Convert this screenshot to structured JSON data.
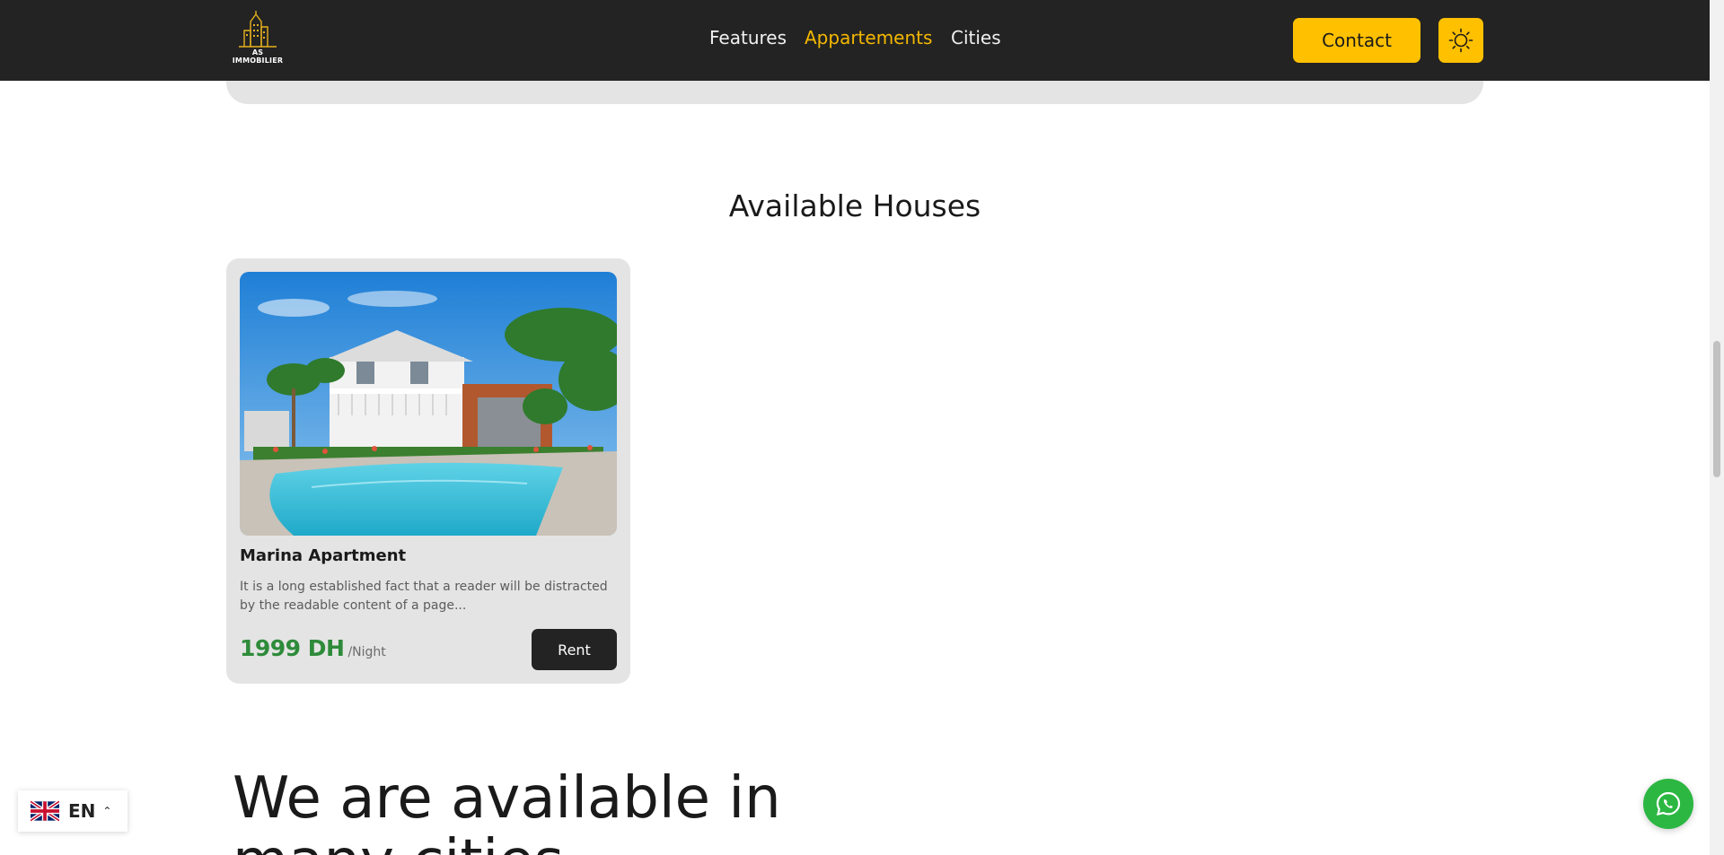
{
  "header": {
    "logo_text": "AS IMMOBILIER",
    "nav": [
      "Features",
      "Appartements",
      "Cities"
    ],
    "active_nav": "Appartements",
    "contact_label": "Contact",
    "theme_icon": "sun-icon"
  },
  "section": {
    "title": "Available Houses"
  },
  "card": {
    "title": "Marina Apartment",
    "description": "It is a long established fact that a reader will be distracted by the readable content of a page...",
    "price": "1999 DH",
    "price_unit": "/Night",
    "rent_label": "Rent"
  },
  "cities": {
    "heading": "We are available in many cities"
  },
  "language": {
    "code": "EN",
    "flag_icon": "uk-flag-icon",
    "caret_icon": "chevron-up-icon"
  },
  "whatsapp": {
    "icon": "whatsapp-icon"
  },
  "colors": {
    "accent": "#ffc000",
    "header_bg": "#232323",
    "price_green": "#2e8b3a"
  }
}
